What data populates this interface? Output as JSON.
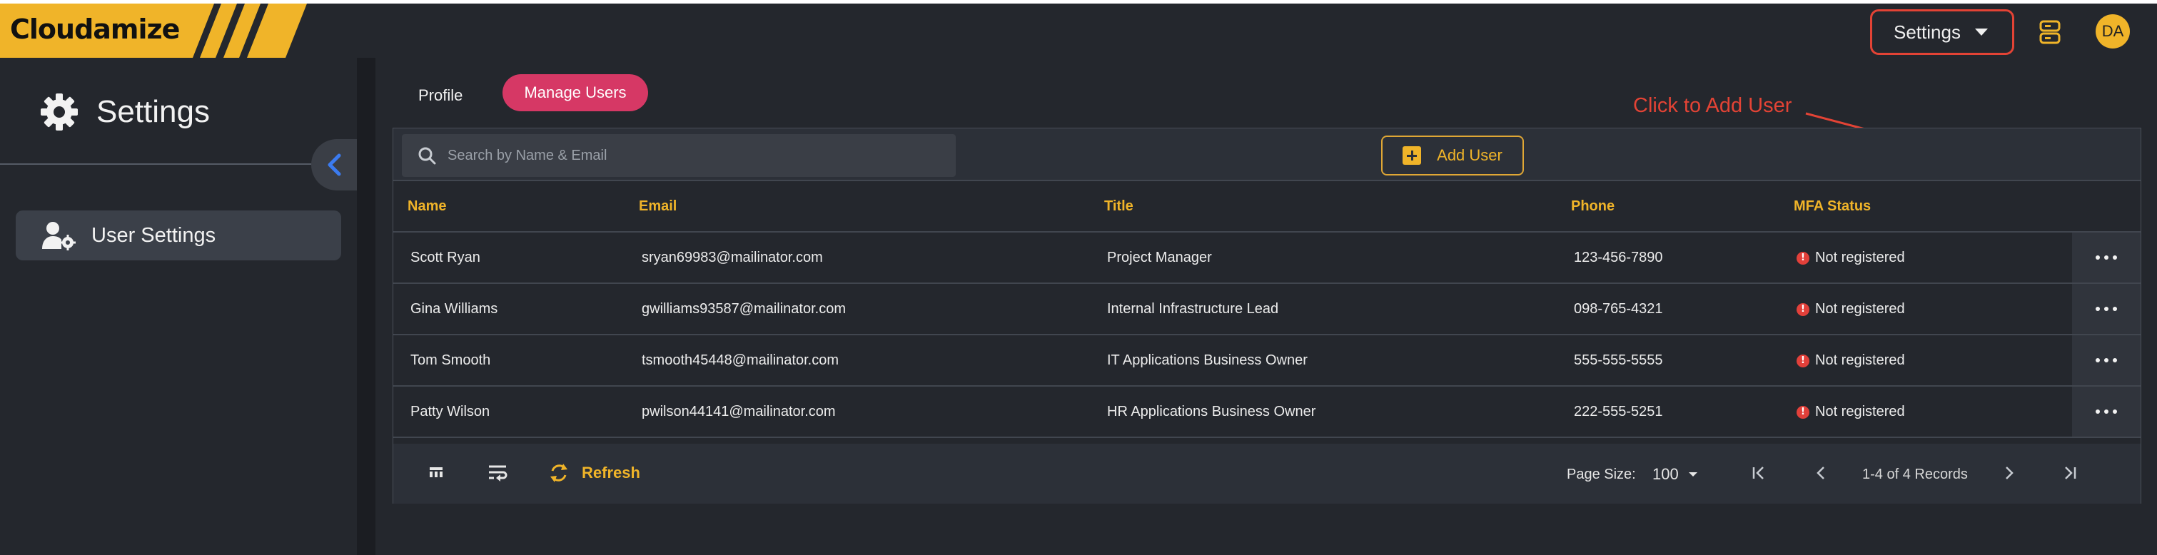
{
  "brand": {
    "name": "Cloudamize"
  },
  "topbar": {
    "settings_label": "Settings",
    "avatar_initials": "DA"
  },
  "sidebar": {
    "title": "Settings",
    "items": [
      {
        "label": "User Settings",
        "icon": "user-gear-icon"
      }
    ]
  },
  "tabs": [
    {
      "label": "Profile",
      "active": false
    },
    {
      "label": "Manage Users",
      "active": true
    }
  ],
  "annotation": {
    "text": "Click to Add User"
  },
  "toolbar": {
    "search_placeholder": "Search by Name & Email",
    "add_user_label": "Add User"
  },
  "table": {
    "columns": [
      "Name",
      "Email",
      "Title",
      "Phone",
      "MFA Status"
    ],
    "rows": [
      {
        "name": "Scott Ryan",
        "email": "sryan69983@mailinator.com",
        "title": "Project Manager",
        "phone": "123-456-7890",
        "mfa": "Not registered"
      },
      {
        "name": "Gina Williams",
        "email": "gwilliams93587@mailinator.com",
        "title": "Internal Infrastructure Lead",
        "phone": "098-765-4321",
        "mfa": "Not registered"
      },
      {
        "name": "Tom Smooth",
        "email": "tsmooth45448@mailinator.com",
        "title": "IT Applications Business Owner",
        "phone": "555-555-5555",
        "mfa": "Not registered"
      },
      {
        "name": "Patty Wilson",
        "email": "pwilson44141@mailinator.com",
        "title": "HR Applications Business Owner",
        "phone": "222-555-5251",
        "mfa": "Not registered"
      }
    ]
  },
  "footer": {
    "refresh_label": "Refresh",
    "page_size_label": "Page Size:",
    "page_size_value": "100",
    "records_text": "1-4 of 4 Records"
  },
  "colors": {
    "accent": "#f0b429",
    "tab_active": "#d63865",
    "annotation": "#e34335",
    "error": "#e2403a",
    "background": "#24272d"
  }
}
